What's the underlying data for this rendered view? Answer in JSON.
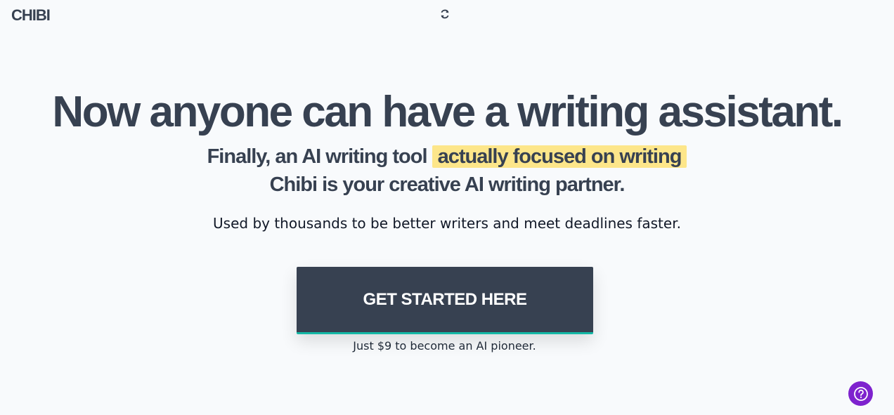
{
  "header": {
    "logo_text": "CHIBI",
    "refresh_icon": "refresh-icon"
  },
  "hero": {
    "title": "Now anyone can have a writing assistant.",
    "subhead_prefix": "Finally, an AI writing tool",
    "subhead_highlight": "actually focused on writing",
    "subhead_line2": "Chibi is your creative AI writing partner.",
    "tagline": "Used by thousands to be better writers and meet deadlines faster."
  },
  "cta": {
    "button_label": "GET STARTED HERE",
    "price_note": "Just $9 to become an AI pioneer."
  },
  "help": {
    "icon": "help-question-icon"
  },
  "colors": {
    "background": "#f8fafc",
    "text_dark": "#374151",
    "highlight": "#fde68a",
    "cta_bg": "#374151",
    "cta_accent": "#14b8a6",
    "help_bg": "#7e22ce"
  }
}
